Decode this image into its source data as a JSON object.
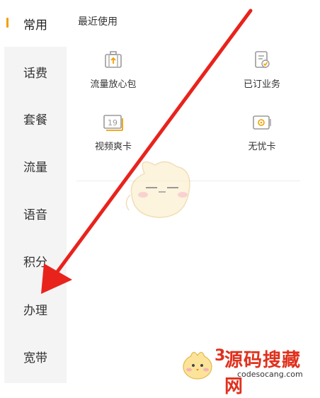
{
  "sidebar": {
    "items": [
      {
        "label": "常用"
      },
      {
        "label": "话费"
      },
      {
        "label": "套餐"
      },
      {
        "label": "流量"
      },
      {
        "label": "语音"
      },
      {
        "label": "积分"
      },
      {
        "label": "办理"
      },
      {
        "label": "宽带"
      }
    ],
    "active_index": 0
  },
  "section": {
    "title": "最近使用"
  },
  "services": [
    {
      "label": "流量放心包",
      "icon": "suitcase-arrow-icon"
    },
    {
      "label": "已订业务",
      "icon": "document-check-icon"
    },
    {
      "label": "视频爽卡",
      "icon": "card-19-icon"
    },
    {
      "label": "无忧卡",
      "icon": "sim-card-icon"
    }
  ],
  "watermark": {
    "number": "3",
    "text": "源码搜藏网",
    "url": "codesocang.com"
  },
  "colors": {
    "accent": "#f0a000",
    "arrow": "#e8231c",
    "watermark": "#e0311d"
  }
}
